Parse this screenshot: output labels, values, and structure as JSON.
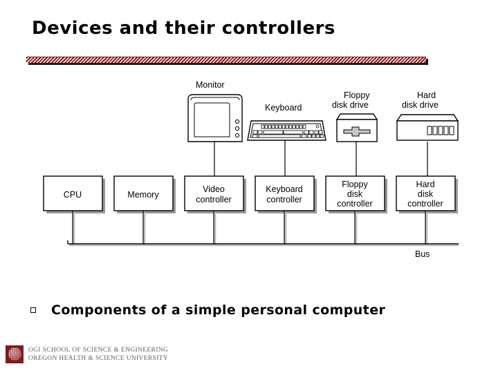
{
  "slide": {
    "title": "Devices and their controllers",
    "bullet_marker": "square-bullet",
    "bullet_text": "Components of a simple personal computer",
    "accent_color": "#8c1a1a"
  },
  "diagram": {
    "bus_label": "Bus",
    "devices": [
      {
        "id": "monitor",
        "label": "Monitor",
        "label_lines": [
          "Monitor"
        ]
      },
      {
        "id": "keyboard",
        "label": "Keyboard",
        "label_lines": [
          "Keyboard"
        ]
      },
      {
        "id": "floppy",
        "label": "Floppy disk drive",
        "label_lines": [
          "Floppy",
          "disk drive"
        ]
      },
      {
        "id": "harddisk",
        "label": "Hard disk drive",
        "label_lines": [
          "Hard",
          "disk drive"
        ]
      }
    ],
    "boxes": [
      {
        "id": "cpu",
        "label": "CPU",
        "label_lines": [
          "CPU"
        ]
      },
      {
        "id": "memory",
        "label": "Memory",
        "label_lines": [
          "Memory"
        ]
      },
      {
        "id": "video-controller",
        "label": "Video controller",
        "label_lines": [
          "Video",
          "controller"
        ]
      },
      {
        "id": "keyboard-controller",
        "label": "Keyboard controller",
        "label_lines": [
          "Keyboard",
          "controller"
        ]
      },
      {
        "id": "floppy-controller",
        "label": "Floppy disk controller",
        "label_lines": [
          "Floppy",
          "disk",
          "controller"
        ]
      },
      {
        "id": "harddisk-controller",
        "label": "Hard disk controller",
        "label_lines": [
          "Hard",
          "disk",
          "controller"
        ]
      }
    ]
  },
  "footer": {
    "line1": "OGI SCHOOL OF SCIENCE & ENGINEERING",
    "line2": "OREGON HEALTH & SCIENCE UNIVERSITY",
    "logo": "ogi-oshu-logo"
  }
}
